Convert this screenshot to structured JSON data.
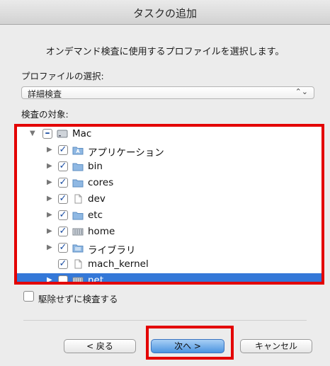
{
  "window": {
    "title": "タスクの追加"
  },
  "instruction": "オンデマンド検査に使用するプロファイルを選択します。",
  "profile": {
    "label": "プロファイルの選択:",
    "selected": "詳細検査",
    "arrows": "⌃⌄"
  },
  "scan_target": {
    "label": "検査の対象:"
  },
  "tree": {
    "items": [
      {
        "label": "Mac",
        "expanded": true,
        "check": "mixed",
        "icon": "hard-drive-icon"
      },
      {
        "label": "アプリケーション",
        "expanded": false,
        "check": "checked",
        "icon": "applications-folder-icon"
      },
      {
        "label": "bin",
        "expanded": false,
        "check": "checked",
        "icon": "folder-icon"
      },
      {
        "label": "cores",
        "expanded": false,
        "check": "checked",
        "icon": "folder-icon"
      },
      {
        "label": "dev",
        "expanded": false,
        "check": "checked",
        "icon": "file-icon"
      },
      {
        "label": "etc",
        "expanded": false,
        "check": "checked",
        "icon": "folder-icon"
      },
      {
        "label": "home",
        "expanded": false,
        "check": "checked",
        "icon": "server-icon"
      },
      {
        "label": "ライブラリ",
        "expanded": false,
        "check": "checked",
        "icon": "library-folder-icon"
      },
      {
        "label": "mach_kernel",
        "expanded": false,
        "check": "checked",
        "icon": "file-icon"
      },
      {
        "label": "net",
        "expanded": false,
        "check": "unchecked",
        "icon": "server-icon",
        "selected": true
      }
    ]
  },
  "no_delete": {
    "label": "駆除せずに検査する",
    "checked": false
  },
  "buttons": {
    "back": "< 戻る",
    "next": "次へ >",
    "cancel": "キャンセル"
  },
  "colors": {
    "highlight_box": "#e30000",
    "selection": "#3478d8",
    "default_button": "#4b94e0"
  }
}
